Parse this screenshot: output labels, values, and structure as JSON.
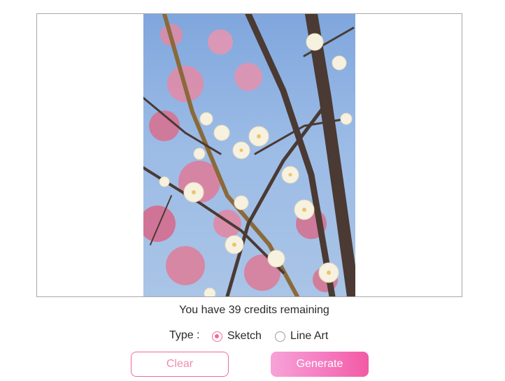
{
  "image": {
    "description_icon": "photo-icon"
  },
  "credits_text": "You have 39 credits remaining",
  "type_selector": {
    "label": "Type :",
    "options": [
      {
        "label": "Sketch",
        "selected": true
      },
      {
        "label": "Line Art",
        "selected": false
      }
    ]
  },
  "buttons": {
    "clear_label": "Clear",
    "generate_label": "Generate"
  },
  "colors": {
    "accent": "#f06a9a",
    "generate_gradient_start": "#f7a3d8",
    "generate_gradient_end": "#f25aa5",
    "frame_border": "#a9a9a9"
  }
}
